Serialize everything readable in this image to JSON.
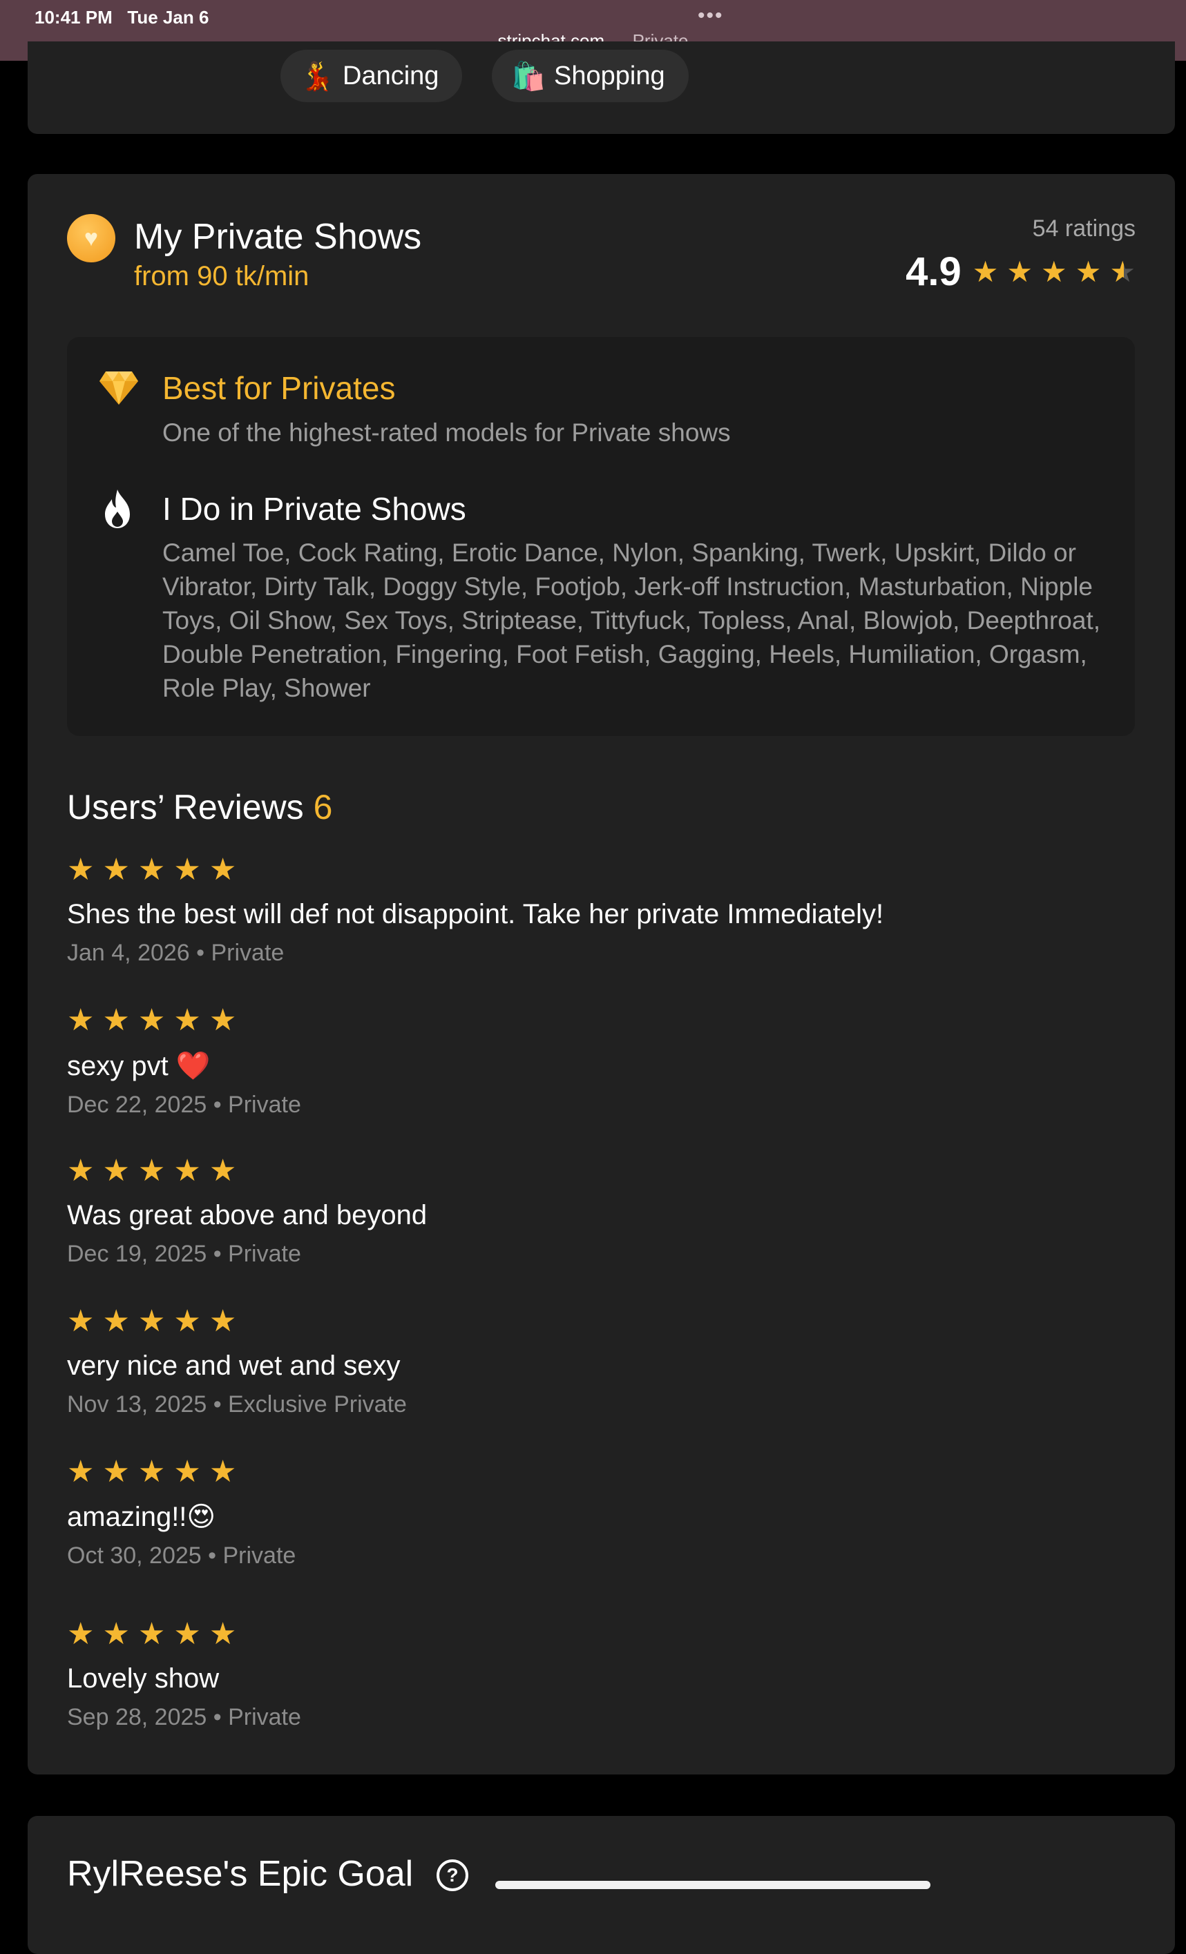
{
  "status_bar": {
    "time": "10:41 PM",
    "date": "Tue Jan 6",
    "dots": "•••",
    "url": "stripchat.com",
    "mode": "— Private"
  },
  "chips": [
    {
      "emoji": "💃",
      "label": "Dancing"
    },
    {
      "emoji": "🛍️",
      "label": "Shopping"
    }
  ],
  "private_shows": {
    "title": "My Private Shows",
    "price": "from 90 tk/min",
    "ratings_count": "54 ratings",
    "rating": "4.9",
    "stars": 4.5,
    "best_title": "Best for Privates",
    "best_subtitle": "One of the highest-rated models for Private shows",
    "ido_title": "I Do in Private Shows",
    "ido_list": "Camel Toe, Cock Rating, Erotic Dance, Nylon, Spanking, Twerk, Upskirt, Dildo or Vibrator, Dirty Talk, Doggy Style, Footjob, Jerk-off Instruction, Masturbation, Nipple Toys, Oil Show, Sex Toys, Striptease, Tittyfuck, Topless, Anal, Blowjob, Deepthroat, Double Penetration, Fingering, Foot Fetish, Gagging, Heels, Humiliation, Orgasm, Role Play, Shower"
  },
  "reviews": {
    "title": "Users’ Reviews",
    "count": "6",
    "items": [
      {
        "stars": 5,
        "text": "Shes the best will def not disappoint. Take her private Immediately!",
        "meta": "Jan 4, 2026 • Private"
      },
      {
        "stars": 5,
        "text": "sexy pvt ❤️",
        "meta": "Dec 22, 2025 • Private"
      },
      {
        "stars": 5,
        "text": "Was great above and beyond",
        "meta": "Dec 19, 2025 • Private"
      },
      {
        "stars": 5,
        "text": "very nice and wet and sexy",
        "meta": "Nov 13, 2025 • Exclusive Private"
      },
      {
        "stars": 5,
        "text": "amazing!!😍",
        "meta": "Oct 30, 2025 • Private"
      },
      {
        "stars": 5,
        "text": "Lovely show",
        "meta": "Sep 28, 2025 • Private"
      }
    ]
  },
  "goal": {
    "title": "RylReese's Epic Goal",
    "help_label": "?"
  },
  "colors": {
    "accent": "#f5b731",
    "card": "#212121",
    "inner_box": "#1b1b1b",
    "muted_text": "#9d9d9d",
    "status_bar": "#5b3e48"
  },
  "icons": {
    "shows": "heart-coin-icon",
    "best": "diamond-icon",
    "ido": "fire-icon",
    "help": "question-circle-icon"
  }
}
